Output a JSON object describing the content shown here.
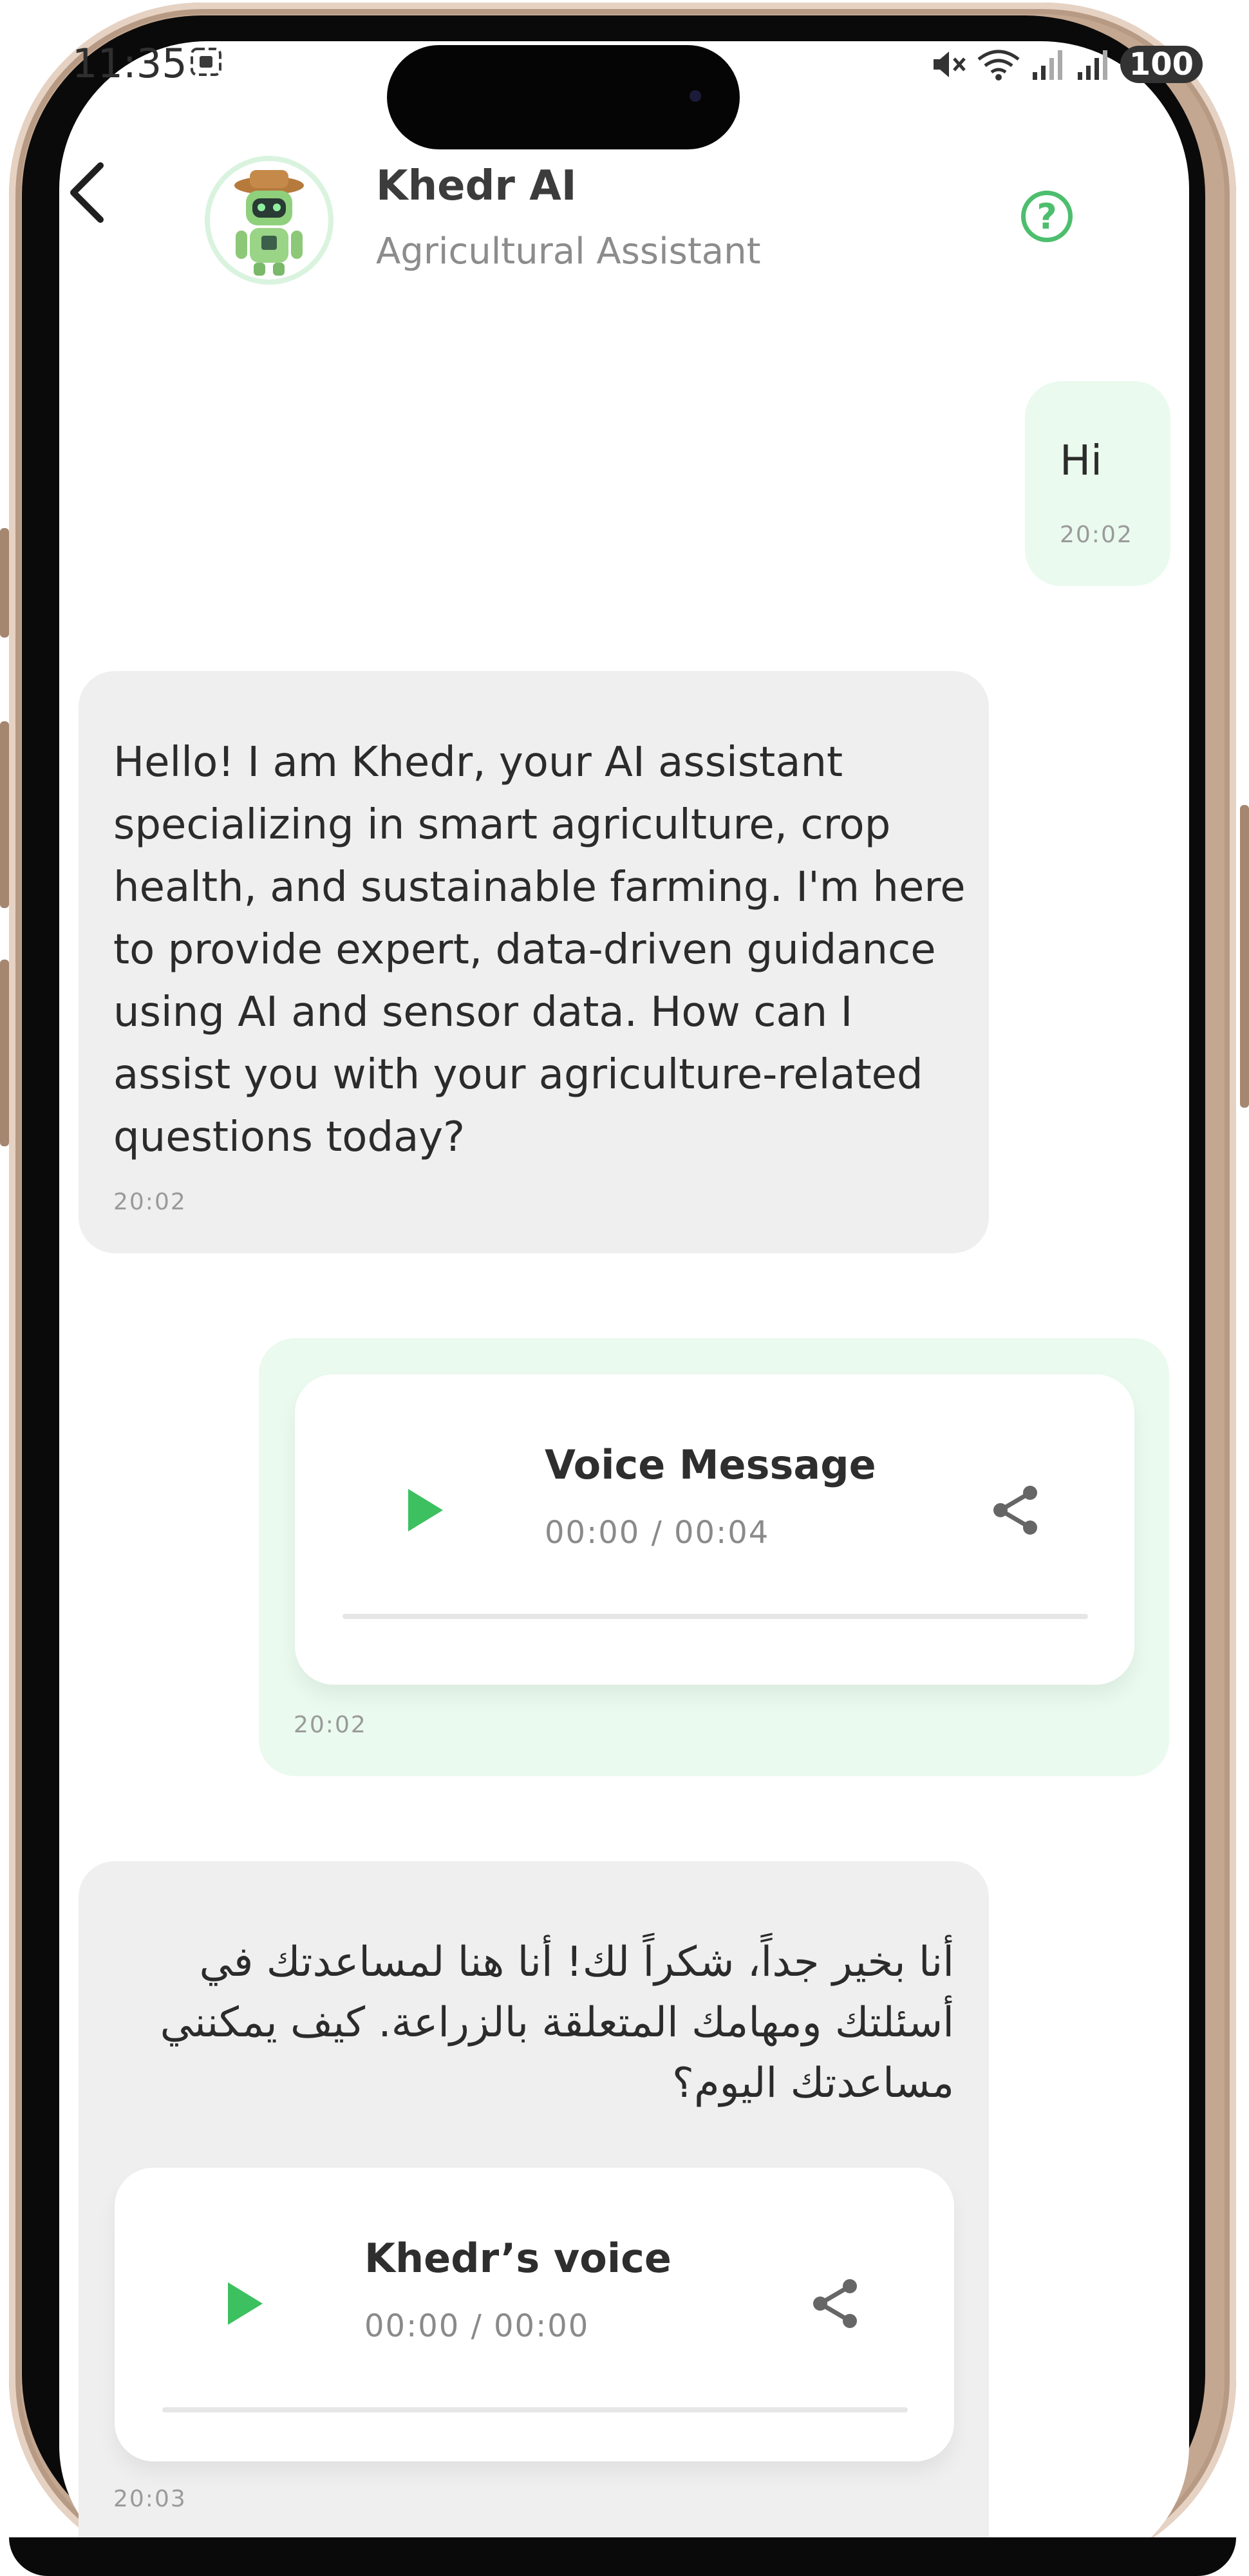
{
  "status_bar": {
    "time": "11:35",
    "battery": "100"
  },
  "header": {
    "title": "Khedr AI",
    "subtitle": "Agricultural Assistant",
    "back_icon": "chevron-left-icon",
    "help_icon": "question-circle-icon",
    "help_glyph": "?"
  },
  "messages": [
    {
      "sender": "user",
      "type": "text",
      "text": "Hi",
      "time": "20:02"
    },
    {
      "sender": "bot",
      "type": "text",
      "text": "Hello! I am Khedr, your AI assistant specializing in smart agriculture, crop health, and sustainable farming. I'm here to provide expert, data-driven guidance using AI and sensor data. How can I assist you with your agriculture-related questions today?",
      "time": "20:02"
    },
    {
      "sender": "user",
      "type": "voice",
      "title": "Voice Message",
      "duration": "00:00 / 00:04",
      "time": "20:02"
    },
    {
      "sender": "bot",
      "type": "text+voice",
      "text": "أنا بخير جداً، شكراً لك! أنا هنا لمساعدتك في أسئلتك ومهامك المتعلقة بالزراعة. كيف يمكنني مساعدتك اليوم؟",
      "voice_title": "Khedr’s voice",
      "duration": "00:00 / 00:00",
      "time": "20:03"
    }
  ],
  "colors": {
    "accent": "#4dbe6d",
    "user_bubble": "#eafaee",
    "bot_bubble": "#efefef"
  }
}
